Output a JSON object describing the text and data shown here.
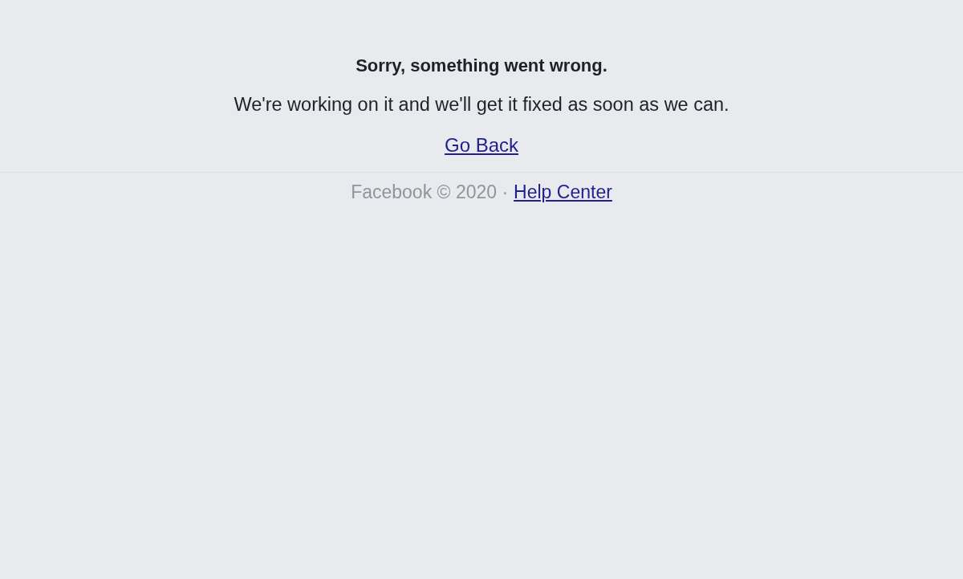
{
  "error": {
    "title": "Sorry, something went wrong.",
    "message": "We're working on it and we'll get it fixed as soon as we can.",
    "link": "Go Back"
  },
  "footer": {
    "text": "Facebook © 2020 ·",
    "link": "Help Center"
  }
}
